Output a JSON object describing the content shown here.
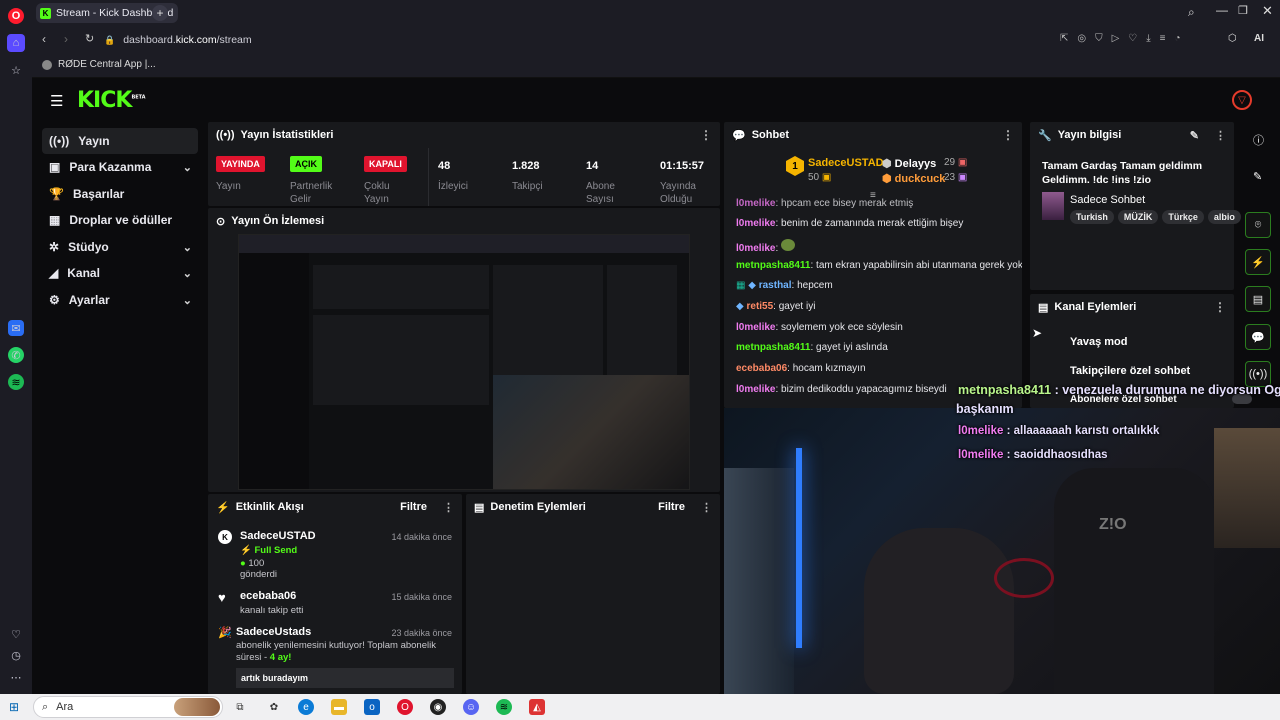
{
  "browser": {
    "tab_title": "Stream - Kick Dashboard",
    "new_tab_label": "+",
    "url_prefix": "dashboard.",
    "url_domain": "kick.com",
    "url_path": "/stream",
    "bookmark": "RØDE Central App |...",
    "ai_label": "AI"
  },
  "kick": {
    "logo": "KICK",
    "logo_sup": "BETA",
    "nav": [
      {
        "label": "Yayın",
        "icon": "broadcast-icon"
      },
      {
        "label": "Para Kazanma",
        "icon": "money-icon"
      },
      {
        "label": "Başarılar",
        "icon": "trophy-icon"
      },
      {
        "label": "Droplar ve ödüller",
        "icon": "gift-icon"
      },
      {
        "label": "Stüdyo",
        "icon": "studio-icon"
      },
      {
        "label": "Kanal",
        "icon": "channel-icon"
      },
      {
        "label": "Ayarlar",
        "icon": "gear-icon"
      }
    ]
  },
  "stats": {
    "title": "Yayın İstatistikleri",
    "items": [
      {
        "badge": "YAYINDA",
        "label": "Yayın"
      },
      {
        "badge": "AÇIK",
        "label": "Partnerlik Gelir"
      },
      {
        "badge": "KAPALI",
        "label": "Çoklu Yayın"
      },
      {
        "value": "48",
        "label": "İzleyici"
      },
      {
        "value": "1.828",
        "label": "Takipçi"
      },
      {
        "value": "14",
        "label": "Abone Sayısı"
      },
      {
        "value": "01:15:57",
        "label": "Yayında Olduğu"
      }
    ]
  },
  "preview": {
    "title": "Yayın Ön İzlemesi"
  },
  "chat": {
    "title": "Sohbet",
    "top": [
      {
        "name": "SadeceUSTAD",
        "count": "50",
        "rank": "1"
      },
      {
        "name": "Delayys",
        "count": "29"
      },
      {
        "name": "duckcuck",
        "count": "23"
      }
    ],
    "messages": [
      {
        "user": "l0melike",
        "text": ": hpcam ece bisey merak etmiş",
        "cls": "u-pink"
      },
      {
        "user": "l0melike",
        "text": ": benim de zamanında merak ettiğim bişey",
        "cls": "u-pink"
      },
      {
        "user": "l0melike",
        "text": ":",
        "cls": "u-pink"
      },
      {
        "user": "metnpasha8411",
        "text": ": tam ekran yapabilirsin abi utanmana gerek yok",
        "cls": "u-green"
      },
      {
        "user": "rasthal",
        "text": ": hepcem",
        "cls": "u-blue"
      },
      {
        "user": "reti55",
        "text": ": gayet iyi",
        "cls": "u-red"
      },
      {
        "user": "l0melike",
        "text": ": soylemem yok ece söylesin",
        "cls": "u-pink"
      },
      {
        "user": "metnpasha8411",
        "text": ": gayet iyi aslında",
        "cls": "u-green"
      },
      {
        "user": "ecebaba06",
        "text": ": hocam kızmayın",
        "cls": "u-red"
      },
      {
        "user": "l0melike",
        "text": ": bizim dedikoddu yapacagımız biseydi",
        "cls": "u-pink"
      }
    ]
  },
  "info": {
    "title": "Yayın bilgisi",
    "stream_title": "Tamam Gardaş Tamam geldimm Geldimm. !dc !ins !zio",
    "category": "Sadece Sohbet",
    "tags": [
      "Turkish",
      "MÜZİK",
      "Türkçe",
      "albio"
    ]
  },
  "actions": {
    "title": "Kanal Eylemleri",
    "items": [
      "Yavaş mod",
      "Takipçilere özel sohbet",
      "Abonelere özel sohbet"
    ]
  },
  "feed": {
    "title": "Etkinlik Akışı",
    "filter": "Filtre",
    "events": [
      {
        "user": "SadeceUSTAD",
        "time": "14 dakika önce",
        "detail": "Full Send",
        "amount": "100",
        "sub": "gönderdi"
      },
      {
        "user": "ecebaba06",
        "time": "15 dakika önce",
        "sub": "kanalı takip etti"
      },
      {
        "user": "SadeceUstads",
        "time": "23 dakika önce",
        "sub": "abonelik yenilemesini kutluyor! Toplam abonelik süresi -",
        "months": "4",
        "months_suffix": " ay!",
        "message": "artık buradayım"
      }
    ]
  },
  "mod": {
    "title": "Denetim Eylemleri",
    "filter": "Filtre"
  },
  "overlay": {
    "lines": [
      {
        "user": "metnpasha8411",
        "text": " : venezuela durumuna ne diyorsun Ogi"
      },
      {
        "user": "",
        "text": "başkanım"
      },
      {
        "user": "l0melike",
        "text": " : allaaaaaah karıstı ortalıkkk"
      },
      {
        "user": "l0melike",
        "text": " : saoiddhaosıdhas"
      }
    ]
  },
  "taskbar": {
    "search_placeholder": "Ara"
  }
}
